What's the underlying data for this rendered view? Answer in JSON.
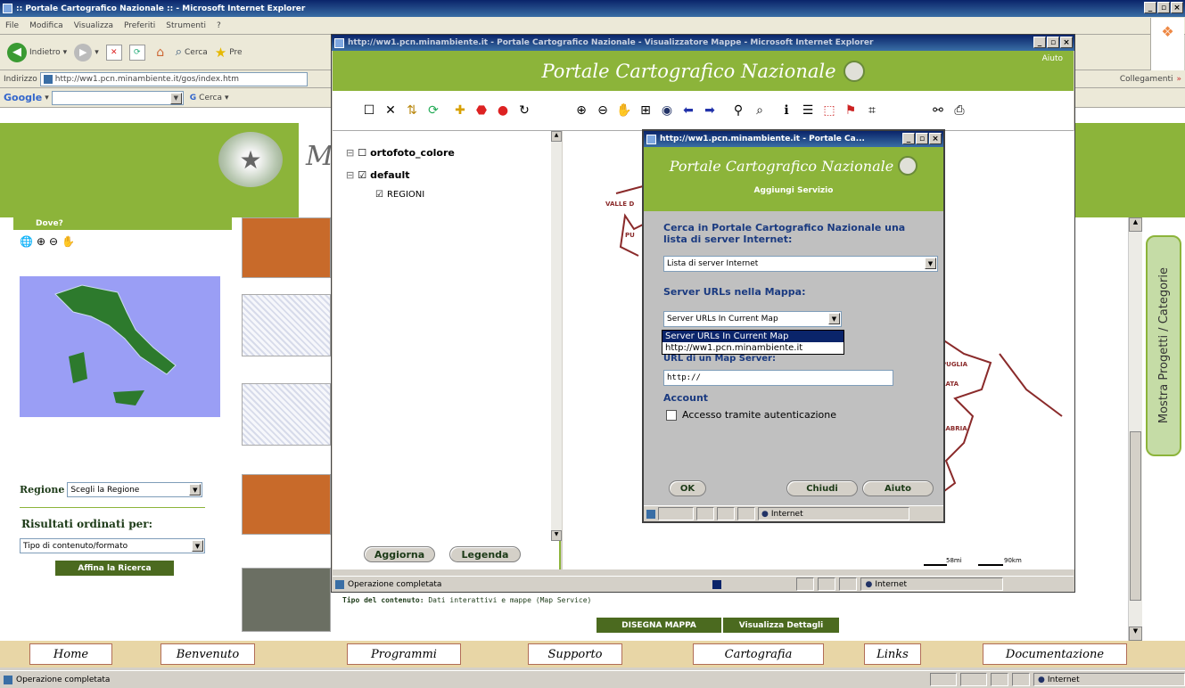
{
  "main_window": {
    "title": ":: Portale Cartografico Nazionale :: - Microsoft Internet Explorer",
    "menu": [
      "File",
      "Modifica",
      "Visualizza",
      "Preferiti",
      "Strumenti",
      "?"
    ],
    "back_label": "Indietro",
    "search_label": "Cerca",
    "favorites_label": "Pre",
    "address_label": "Indirizzo",
    "address_value": "http://ww1.pcn.minambiente.it/gos/index.htm",
    "links_label": "Collegamenti",
    "google_label": "Google",
    "google_search_label": "Cerca",
    "status_text": "Operazione completata",
    "zone_text": "Internet"
  },
  "left_panel": {
    "dove_label": "Dove?",
    "regione_label": "Regione",
    "regione_value": "Scegli la Regione",
    "risultati_label": "Risultati ordinati per:",
    "ordina_value": "Tipo di contenuto/formato",
    "affina_label": "Affina la Ricerca"
  },
  "bottom_nav": [
    "Home",
    "Benvenuto",
    "Programmi",
    "Supporto",
    "Cartografia",
    "Links",
    "Documentazione"
  ],
  "side_tab": {
    "label": "Mostra Progetti / Categorie"
  },
  "results": {
    "tipo_label": "Tipo del contenuto:",
    "tipo_value": "Dati interattivi e mappe (Map Service)",
    "disegna_label": "DISEGNA MAPPA",
    "dettagli_label": "Visualizza Dettagli"
  },
  "viewer_window": {
    "title": "http://ww1.pcn.minambiente.it - Portale Cartografico Nazionale - Visualizzatore Mappe - Microsoft Internet Explorer",
    "aiuto_label": "Aiuto",
    "banner": "Portale Cartografico Nazionale",
    "layers": [
      {
        "label": "ortofoto_colore",
        "checked": false
      },
      {
        "label": "default",
        "checked": true
      },
      {
        "label": "REGIONI",
        "checked": true
      }
    ],
    "aggiorna_label": "Aggiorna",
    "legenda_label": "Legenda",
    "scale_text_1": "58mi",
    "scale_text_2": "90km",
    "status_text": "Operazione completata",
    "zone_text": "Internet",
    "map_labels": [
      "VALLE D",
      "PU",
      "PUGLIA",
      "LATA",
      "LABRIA"
    ]
  },
  "dialog": {
    "title": "http://ww1.pcn.minambiente.it - Portale Ca...",
    "banner": "Portale Cartografico Nazionale",
    "subtitle": "Aggiungi Servizio",
    "cerca_label": "Cerca in Portale Cartografico Nazionale una lista di server Internet:",
    "lista_value": "Lista di server Internet",
    "server_urls_label": "Server URLs nella Mappa:",
    "server_select_value": "Server URLs In Current Map",
    "dropdown_options": [
      "Server URLs In Current Map",
      "http://ww1.pcn.minambiente.it"
    ],
    "url_label": "URL di un Map Server:",
    "url_value": "http://",
    "account_label": "Account",
    "auth_label": "Accesso tramite autenticazione",
    "ok_label": "OK",
    "chiudi_label": "Chiudi",
    "aiuto_label": "Aiuto",
    "status_zone": "Internet"
  }
}
